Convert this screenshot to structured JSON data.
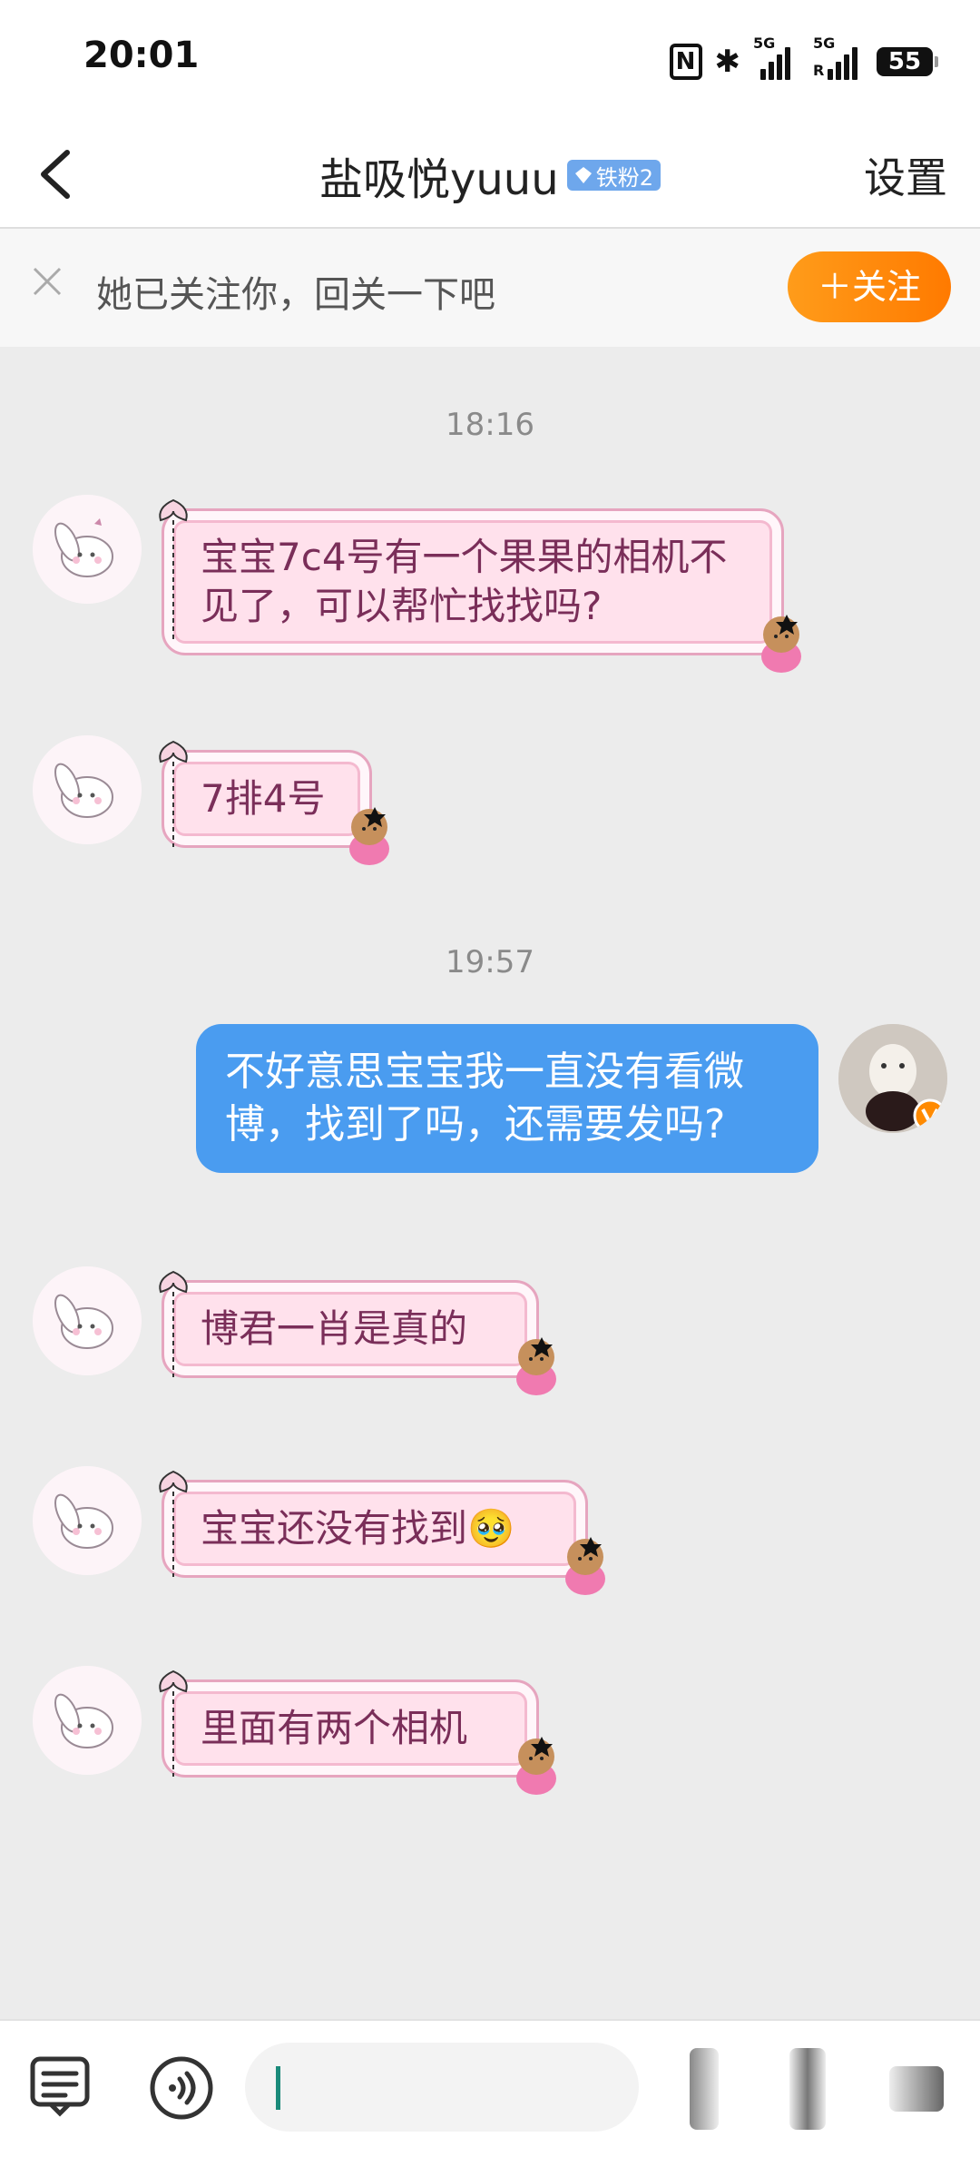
{
  "status_bar": {
    "time": "20:01",
    "nfc": "N",
    "bluetooth": "✱",
    "net1": "5G",
    "net2": "5G",
    "net2_sub": "R",
    "battery": "55"
  },
  "header": {
    "title": "盐吸悦yuuu",
    "badge": "铁粉2",
    "settings_label": "设置"
  },
  "follow_prompt": {
    "text": "她已关注你，回关一下吧",
    "button": "＋关注"
  },
  "messages": {
    "t1": "18:16",
    "m1": "宝宝7c4号有一个果果的相机不见了，可以帮忙找找吗?",
    "m2": "7排4号",
    "t2": "19:57",
    "m3": "不好意思宝宝我一直没有看微博，找到了吗，还需要发吗?",
    "m4": "博君一肖是真的",
    "m5": "宝宝还没有找到",
    "m5_emoji": "🥹",
    "m6": "里面有两个相机"
  },
  "colors": {
    "accent_orange": "#ff8a00",
    "bubble_out": "#4a9cf0",
    "bubble_in": "#ffe1ec",
    "verified": "#ff8a00"
  },
  "icons": [
    "back-chevron-icon",
    "diamond-icon",
    "close-icon",
    "keyboard-menu-icon",
    "voice-icon",
    "verified-icon"
  ]
}
